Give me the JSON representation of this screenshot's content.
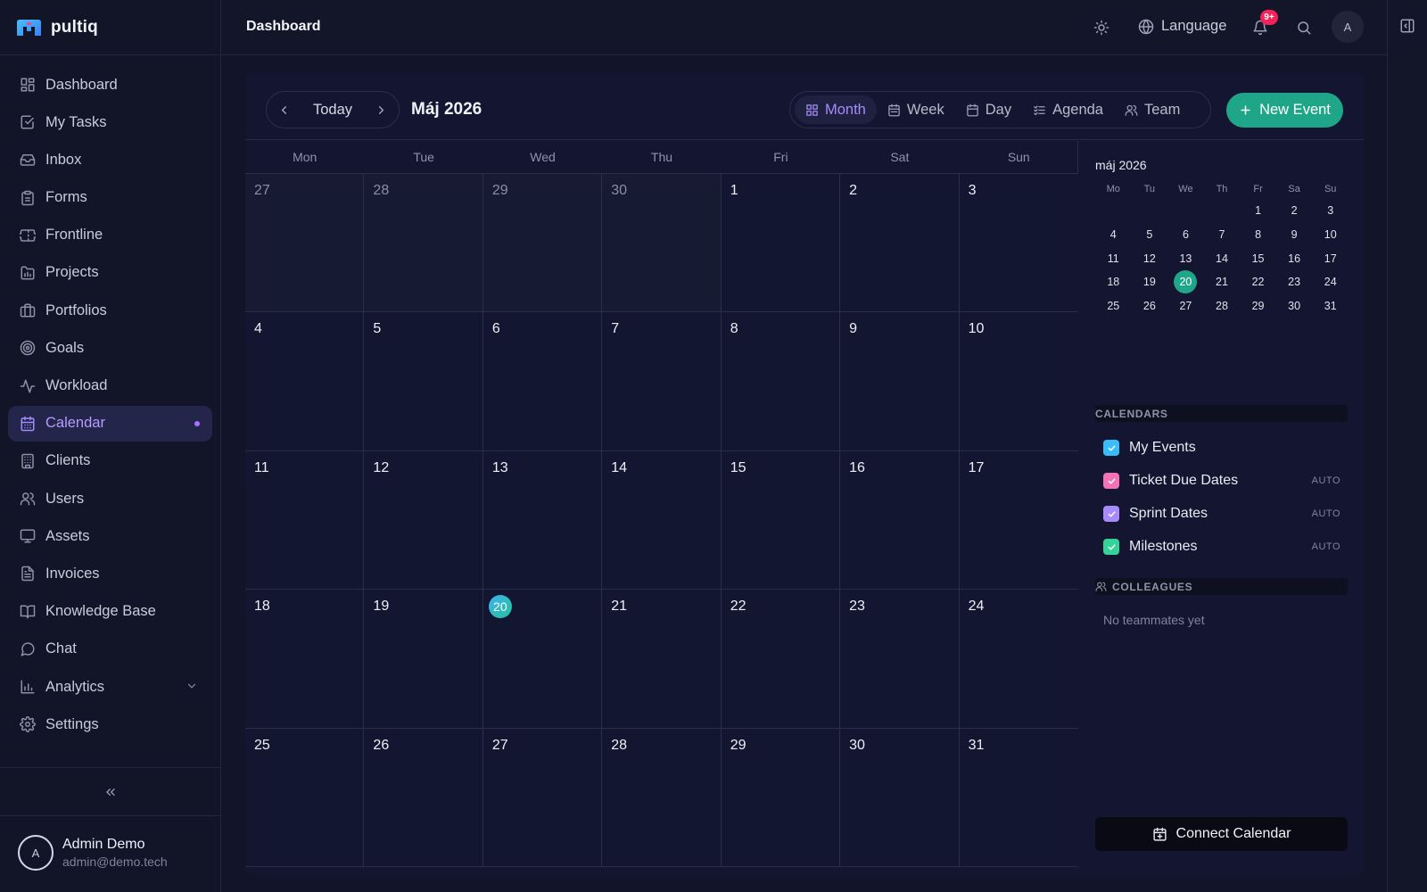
{
  "brand": {
    "name": "pultiq"
  },
  "colors": {
    "accent": "#a78bfa",
    "primary": "#1fa688",
    "badge": "#f0235a"
  },
  "sidebar": {
    "items": [
      {
        "label": "Dashboard",
        "icon": "dashboard-icon"
      },
      {
        "label": "My Tasks",
        "icon": "checkbox-icon"
      },
      {
        "label": "Inbox",
        "icon": "inbox-icon"
      },
      {
        "label": "Forms",
        "icon": "clipboard-icon"
      },
      {
        "label": "Frontline",
        "icon": "ticket-icon"
      },
      {
        "label": "Projects",
        "icon": "folder-chart-icon"
      },
      {
        "label": "Portfolios",
        "icon": "briefcase-icon"
      },
      {
        "label": "Goals",
        "icon": "target-icon"
      },
      {
        "label": "Workload",
        "icon": "activity-icon"
      },
      {
        "label": "Calendar",
        "icon": "calendar-icon",
        "active": true
      },
      {
        "label": "Clients",
        "icon": "building-icon"
      },
      {
        "label": "Users",
        "icon": "users-icon"
      },
      {
        "label": "Assets",
        "icon": "monitor-icon"
      },
      {
        "label": "Invoices",
        "icon": "file-text-icon"
      },
      {
        "label": "Knowledge Base",
        "icon": "book-icon"
      },
      {
        "label": "Chat",
        "icon": "chat-icon"
      },
      {
        "label": "Analytics",
        "icon": "bar-chart-icon",
        "expandable": true
      },
      {
        "label": "Settings",
        "icon": "gear-icon"
      }
    ],
    "collapse_icon": "chevrons-left-icon"
  },
  "user": {
    "initial": "A",
    "name": "Admin Demo",
    "email": "admin@demo.tech"
  },
  "header": {
    "title": "Dashboard",
    "language_label": "Language",
    "notification_badge": "9+",
    "avatar_initial": "A"
  },
  "calendar": {
    "today_label": "Today",
    "month_title": "Máj 2026",
    "views": [
      {
        "label": "Month",
        "icon": "grid-icon",
        "active": true
      },
      {
        "label": "Week",
        "icon": "calendar-week-icon"
      },
      {
        "label": "Day",
        "icon": "calendar-day-icon"
      },
      {
        "label": "Agenda",
        "icon": "list-check-icon"
      },
      {
        "label": "Team",
        "icon": "users-icon"
      }
    ],
    "new_event_label": "New Event",
    "weekdays": [
      "Mon",
      "Tue",
      "Wed",
      "Thu",
      "Fri",
      "Sat",
      "Sun"
    ],
    "weeks": [
      [
        {
          "d": "27",
          "out": true
        },
        {
          "d": "28",
          "out": true
        },
        {
          "d": "29",
          "out": true
        },
        {
          "d": "30",
          "out": true
        },
        {
          "d": "1"
        },
        {
          "d": "2"
        },
        {
          "d": "3"
        }
      ],
      [
        {
          "d": "4"
        },
        {
          "d": "5"
        },
        {
          "d": "6"
        },
        {
          "d": "7"
        },
        {
          "d": "8"
        },
        {
          "d": "9"
        },
        {
          "d": "10"
        }
      ],
      [
        {
          "d": "11"
        },
        {
          "d": "12"
        },
        {
          "d": "13"
        },
        {
          "d": "14"
        },
        {
          "d": "15"
        },
        {
          "d": "16"
        },
        {
          "d": "17"
        }
      ],
      [
        {
          "d": "18"
        },
        {
          "d": "19"
        },
        {
          "d": "20",
          "today": true
        },
        {
          "d": "21"
        },
        {
          "d": "22"
        },
        {
          "d": "23"
        },
        {
          "d": "24"
        }
      ],
      [
        {
          "d": "25"
        },
        {
          "d": "26"
        },
        {
          "d": "27"
        },
        {
          "d": "28"
        },
        {
          "d": "29"
        },
        {
          "d": "30"
        },
        {
          "d": "31"
        }
      ]
    ]
  },
  "mini_calendar": {
    "title": "máj 2026",
    "weekdays": [
      "Mo",
      "Tu",
      "We",
      "Th",
      "Fr",
      "Sa",
      "Su"
    ],
    "leading_blanks": 4,
    "days": [
      "1",
      "2",
      "3",
      "4",
      "5",
      "6",
      "7",
      "8",
      "9",
      "10",
      "11",
      "12",
      "13",
      "14",
      "15",
      "16",
      "17",
      "18",
      "19",
      "20",
      "21",
      "22",
      "23",
      "24",
      "25",
      "26",
      "27",
      "28",
      "29",
      "30",
      "31"
    ],
    "selected": "20"
  },
  "calendars_section": {
    "title": "CALENDARS",
    "items": [
      {
        "label": "My Events",
        "color": "#38bdf8",
        "tag": ""
      },
      {
        "label": "Ticket Due Dates",
        "color": "#f472b6",
        "tag": "AUTO"
      },
      {
        "label": "Sprint Dates",
        "color": "#a78bfa",
        "tag": "AUTO"
      },
      {
        "label": "Milestones",
        "color": "#34d399",
        "tag": "AUTO"
      }
    ]
  },
  "colleagues_section": {
    "title": "COLLEAGUES",
    "empty_text": "No teammates yet"
  },
  "connect_label": "Connect Calendar"
}
